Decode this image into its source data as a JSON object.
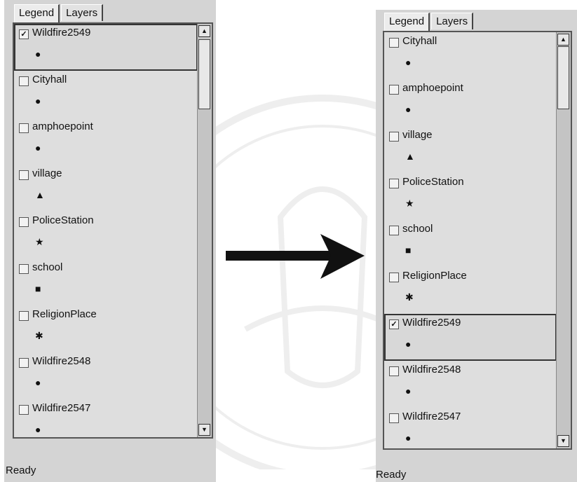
{
  "left_panel": {
    "tabs": [
      {
        "label": "Legend",
        "active": true
      },
      {
        "label": "Layers",
        "active": false
      }
    ],
    "status": "Ready",
    "layers": [
      {
        "name": "Wildfire2549",
        "checked": true,
        "symbol": "●",
        "selected": true
      },
      {
        "name": "Cityhall",
        "checked": false,
        "symbol": "●",
        "selected": false
      },
      {
        "name": "amphoepoint",
        "checked": false,
        "symbol": "●",
        "selected": false
      },
      {
        "name": "village",
        "checked": false,
        "symbol": "▲",
        "selected": false
      },
      {
        "name": "PoliceStation",
        "checked": false,
        "symbol": "★",
        "selected": false
      },
      {
        "name": "school",
        "checked": false,
        "symbol": "■",
        "selected": false
      },
      {
        "name": "ReligionPlace",
        "checked": false,
        "symbol": "✱",
        "selected": false
      },
      {
        "name": "Wildfire2548",
        "checked": false,
        "symbol": "●",
        "selected": false
      },
      {
        "name": "Wildfire2547",
        "checked": false,
        "symbol": "●",
        "selected": false
      }
    ]
  },
  "right_panel": {
    "tabs": [
      {
        "label": "Legend",
        "active": true
      },
      {
        "label": "Layers",
        "active": false
      }
    ],
    "status": "Ready",
    "layers": [
      {
        "name": "Cityhall",
        "checked": false,
        "symbol": "●",
        "selected": false
      },
      {
        "name": "amphoepoint",
        "checked": false,
        "symbol": "●",
        "selected": false
      },
      {
        "name": "village",
        "checked": false,
        "symbol": "▲",
        "selected": false
      },
      {
        "name": "PoliceStation",
        "checked": false,
        "symbol": "★",
        "selected": false
      },
      {
        "name": "school",
        "checked": false,
        "symbol": "■",
        "selected": false
      },
      {
        "name": "ReligionPlace",
        "checked": false,
        "symbol": "✱",
        "selected": false
      },
      {
        "name": "Wildfire2549",
        "checked": true,
        "symbol": "●",
        "selected": true
      },
      {
        "name": "Wildfire2548",
        "checked": false,
        "symbol": "●",
        "selected": false
      },
      {
        "name": "Wildfire2547",
        "checked": false,
        "symbol": "●",
        "selected": false
      }
    ]
  },
  "scroll_arrows": {
    "up": "▲",
    "down": "▼"
  },
  "check_mark": "✓",
  "icons": {
    "transition_arrow": "right-arrow-icon"
  },
  "colors": {
    "panel_bg": "#d4d4d4",
    "list_bg": "#dedede",
    "arrow": "#111111"
  }
}
